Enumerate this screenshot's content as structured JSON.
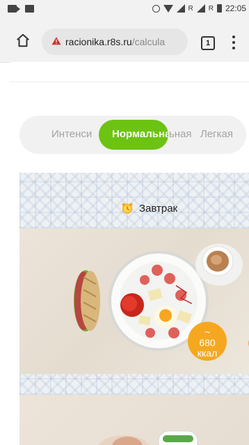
{
  "status_bar": {
    "time": "22:05",
    "net1": "R",
    "net2": "R"
  },
  "browser": {
    "url_host": "racionika.r8s.ru",
    "url_path": "/calcula",
    "tab_count": "1"
  },
  "segmented": {
    "options": [
      "Интенси",
      "Нормальная",
      "Легкая"
    ],
    "selected": "Нормальная",
    "accent_color": "#6dc312"
  },
  "meal": {
    "title": "Завтрак",
    "kcal_tilde": "~",
    "kcal_value": "680",
    "kcal_unit": "ккал",
    "accent_color": "#f5a81f"
  }
}
